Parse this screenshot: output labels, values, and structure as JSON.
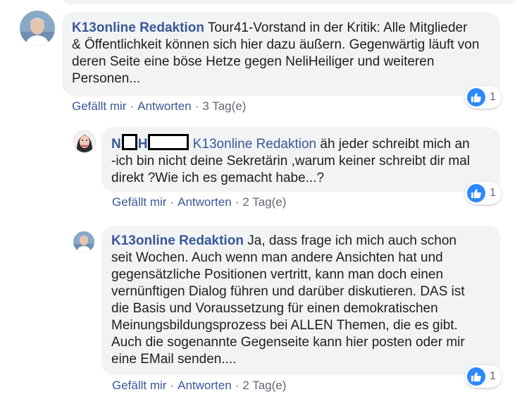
{
  "comments": [
    {
      "author": "K13online Redaktion",
      "text_lines": [
        "Tour41-Vorstand in der Kritik: Alle Mitglieder",
        "& Öffentlichkeit können sich hier dazu äußern. Gegenwärtig läuft von",
        "deren Seite eine böse Hetze gegen NeliHeiliger und weiteren",
        "Personen..."
      ],
      "reaction_count": "1",
      "like_label": "Gefällt mir",
      "reply_label": "Antworten",
      "time": "3 Tag(e)"
    },
    {
      "author_first_initial": "N",
      "author_last_initial": "H",
      "mention": "K13online Redaktion",
      "text_lines": [
        "äh jeder schreibt mich an",
        "-ich bin nicht deine Sekretärin ,warum keiner schreibt dir mal",
        "direkt ?Wie ich es gemacht habe...?"
      ],
      "reaction_count": "1",
      "like_label": "Gefällt mir",
      "reply_label": "Antworten",
      "time": "2 Tag(e)"
    },
    {
      "author": "K13online Redaktion",
      "text_lines": [
        "Ja, dass frage ich mich auch schon",
        "seit Wochen. Auch wenn man andere Ansichten hat und",
        "gegensätzliche Positionen vertritt, kann man doch einen",
        "vernünftigen Dialog führen und darüber diskutieren. DAS ist",
        "die Basis und Voraussetzung für einen demokratischen",
        "Meinungsbildungsprozess bei ALLEN Themen, die es gibt.",
        "Auch die sogenannte Gegenseite kann hier posten oder mir",
        "eine EMail senden...."
      ],
      "reaction_count": "1",
      "like_label": "Gefällt mir",
      "reply_label": "Antworten",
      "time": "2 Tag(e)"
    }
  ],
  "colors": {
    "author_link": "#385898",
    "bubble_bg": "#f2f3f5",
    "meta_text": "#606770",
    "like_blue": "#2d88ff"
  },
  "icons": {
    "reaction": "like-thumbs-up-icon"
  }
}
